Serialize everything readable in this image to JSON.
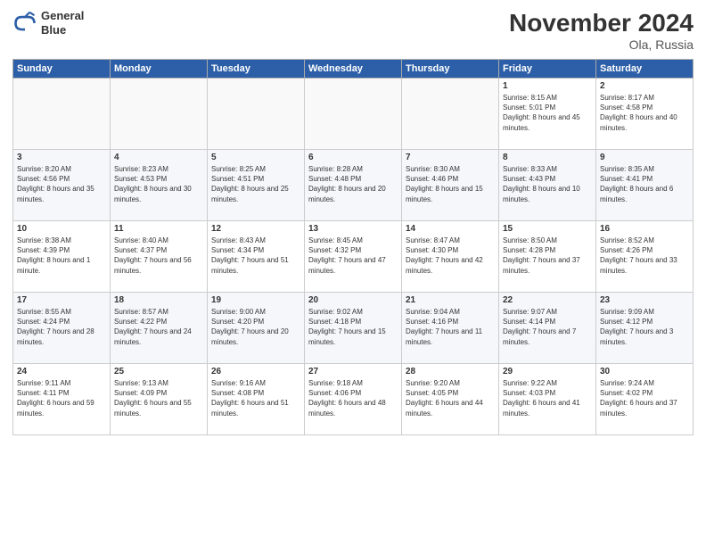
{
  "header": {
    "logo_line1": "General",
    "logo_line2": "Blue",
    "month": "November 2024",
    "location": "Ola, Russia"
  },
  "weekdays": [
    "Sunday",
    "Monday",
    "Tuesday",
    "Wednesday",
    "Thursday",
    "Friday",
    "Saturday"
  ],
  "weeks": [
    [
      {
        "day": "",
        "info": ""
      },
      {
        "day": "",
        "info": ""
      },
      {
        "day": "",
        "info": ""
      },
      {
        "day": "",
        "info": ""
      },
      {
        "day": "",
        "info": ""
      },
      {
        "day": "1",
        "info": "Sunrise: 8:15 AM\nSunset: 5:01 PM\nDaylight: 8 hours and 45 minutes."
      },
      {
        "day": "2",
        "info": "Sunrise: 8:17 AM\nSunset: 4:58 PM\nDaylight: 8 hours and 40 minutes."
      }
    ],
    [
      {
        "day": "3",
        "info": "Sunrise: 8:20 AM\nSunset: 4:56 PM\nDaylight: 8 hours and 35 minutes."
      },
      {
        "day": "4",
        "info": "Sunrise: 8:23 AM\nSunset: 4:53 PM\nDaylight: 8 hours and 30 minutes."
      },
      {
        "day": "5",
        "info": "Sunrise: 8:25 AM\nSunset: 4:51 PM\nDaylight: 8 hours and 25 minutes."
      },
      {
        "day": "6",
        "info": "Sunrise: 8:28 AM\nSunset: 4:48 PM\nDaylight: 8 hours and 20 minutes."
      },
      {
        "day": "7",
        "info": "Sunrise: 8:30 AM\nSunset: 4:46 PM\nDaylight: 8 hours and 15 minutes."
      },
      {
        "day": "8",
        "info": "Sunrise: 8:33 AM\nSunset: 4:43 PM\nDaylight: 8 hours and 10 minutes."
      },
      {
        "day": "9",
        "info": "Sunrise: 8:35 AM\nSunset: 4:41 PM\nDaylight: 8 hours and 6 minutes."
      }
    ],
    [
      {
        "day": "10",
        "info": "Sunrise: 8:38 AM\nSunset: 4:39 PM\nDaylight: 8 hours and 1 minute."
      },
      {
        "day": "11",
        "info": "Sunrise: 8:40 AM\nSunset: 4:37 PM\nDaylight: 7 hours and 56 minutes."
      },
      {
        "day": "12",
        "info": "Sunrise: 8:43 AM\nSunset: 4:34 PM\nDaylight: 7 hours and 51 minutes."
      },
      {
        "day": "13",
        "info": "Sunrise: 8:45 AM\nSunset: 4:32 PM\nDaylight: 7 hours and 47 minutes."
      },
      {
        "day": "14",
        "info": "Sunrise: 8:47 AM\nSunset: 4:30 PM\nDaylight: 7 hours and 42 minutes."
      },
      {
        "day": "15",
        "info": "Sunrise: 8:50 AM\nSunset: 4:28 PM\nDaylight: 7 hours and 37 minutes."
      },
      {
        "day": "16",
        "info": "Sunrise: 8:52 AM\nSunset: 4:26 PM\nDaylight: 7 hours and 33 minutes."
      }
    ],
    [
      {
        "day": "17",
        "info": "Sunrise: 8:55 AM\nSunset: 4:24 PM\nDaylight: 7 hours and 28 minutes."
      },
      {
        "day": "18",
        "info": "Sunrise: 8:57 AM\nSunset: 4:22 PM\nDaylight: 7 hours and 24 minutes."
      },
      {
        "day": "19",
        "info": "Sunrise: 9:00 AM\nSunset: 4:20 PM\nDaylight: 7 hours and 20 minutes."
      },
      {
        "day": "20",
        "info": "Sunrise: 9:02 AM\nSunset: 4:18 PM\nDaylight: 7 hours and 15 minutes."
      },
      {
        "day": "21",
        "info": "Sunrise: 9:04 AM\nSunset: 4:16 PM\nDaylight: 7 hours and 11 minutes."
      },
      {
        "day": "22",
        "info": "Sunrise: 9:07 AM\nSunset: 4:14 PM\nDaylight: 7 hours and 7 minutes."
      },
      {
        "day": "23",
        "info": "Sunrise: 9:09 AM\nSunset: 4:12 PM\nDaylight: 7 hours and 3 minutes."
      }
    ],
    [
      {
        "day": "24",
        "info": "Sunrise: 9:11 AM\nSunset: 4:11 PM\nDaylight: 6 hours and 59 minutes."
      },
      {
        "day": "25",
        "info": "Sunrise: 9:13 AM\nSunset: 4:09 PM\nDaylight: 6 hours and 55 minutes."
      },
      {
        "day": "26",
        "info": "Sunrise: 9:16 AM\nSunset: 4:08 PM\nDaylight: 6 hours and 51 minutes."
      },
      {
        "day": "27",
        "info": "Sunrise: 9:18 AM\nSunset: 4:06 PM\nDaylight: 6 hours and 48 minutes."
      },
      {
        "day": "28",
        "info": "Sunrise: 9:20 AM\nSunset: 4:05 PM\nDaylight: 6 hours and 44 minutes."
      },
      {
        "day": "29",
        "info": "Sunrise: 9:22 AM\nSunset: 4:03 PM\nDaylight: 6 hours and 41 minutes."
      },
      {
        "day": "30",
        "info": "Sunrise: 9:24 AM\nSunset: 4:02 PM\nDaylight: 6 hours and 37 minutes."
      }
    ]
  ]
}
